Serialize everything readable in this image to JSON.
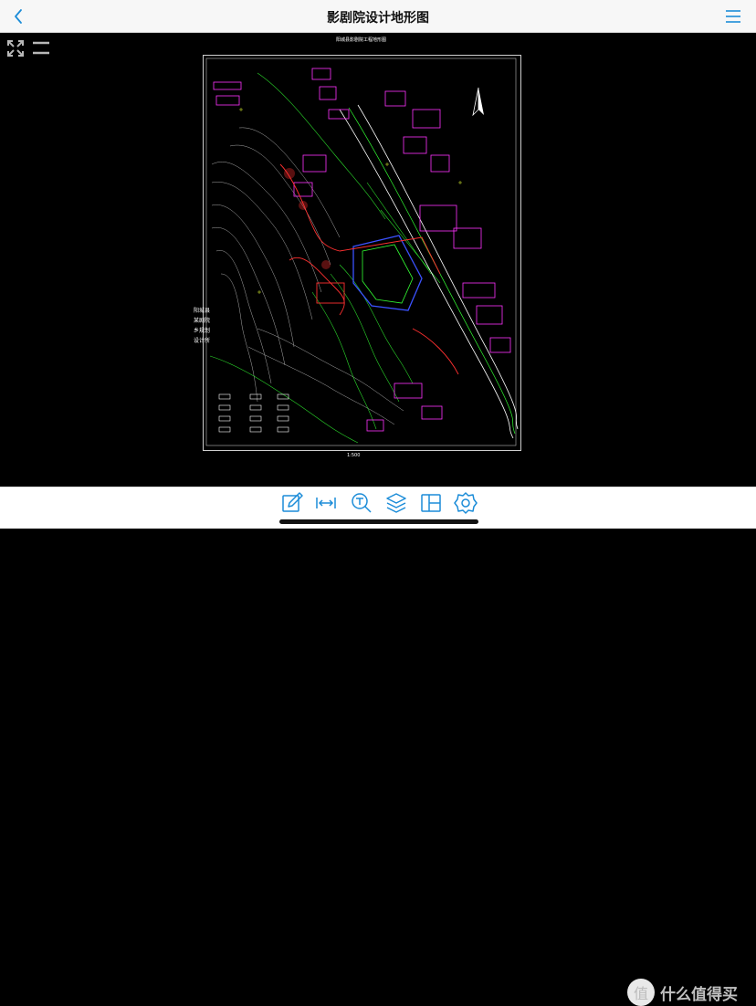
{
  "header": {
    "title": "影剧院设计地形图",
    "back_icon": "chevron-left-icon",
    "menu_icon": "hamburger-menu-icon"
  },
  "drawing": {
    "title": "阳城县影剧院工程地形图",
    "side_note": "阳城县某剧院乡规划设计所",
    "scale": "1:500"
  },
  "toolbar": {
    "tools": [
      "pen-icon",
      "measure-distance-icon",
      "text-search-icon",
      "layers-icon",
      "split-view-icon",
      "settings-icon"
    ]
  },
  "watermark": {
    "badge": "值",
    "text": "什么值得买"
  },
  "colors": {
    "accent": "#1b8cd8",
    "cad_magenta": "#ff33ff",
    "cad_green": "#33ff33",
    "cad_red": "#ff3030",
    "cad_blue": "#3b52ff",
    "cad_white": "#ffffff",
    "cad_yellow": "#e6ff33"
  }
}
